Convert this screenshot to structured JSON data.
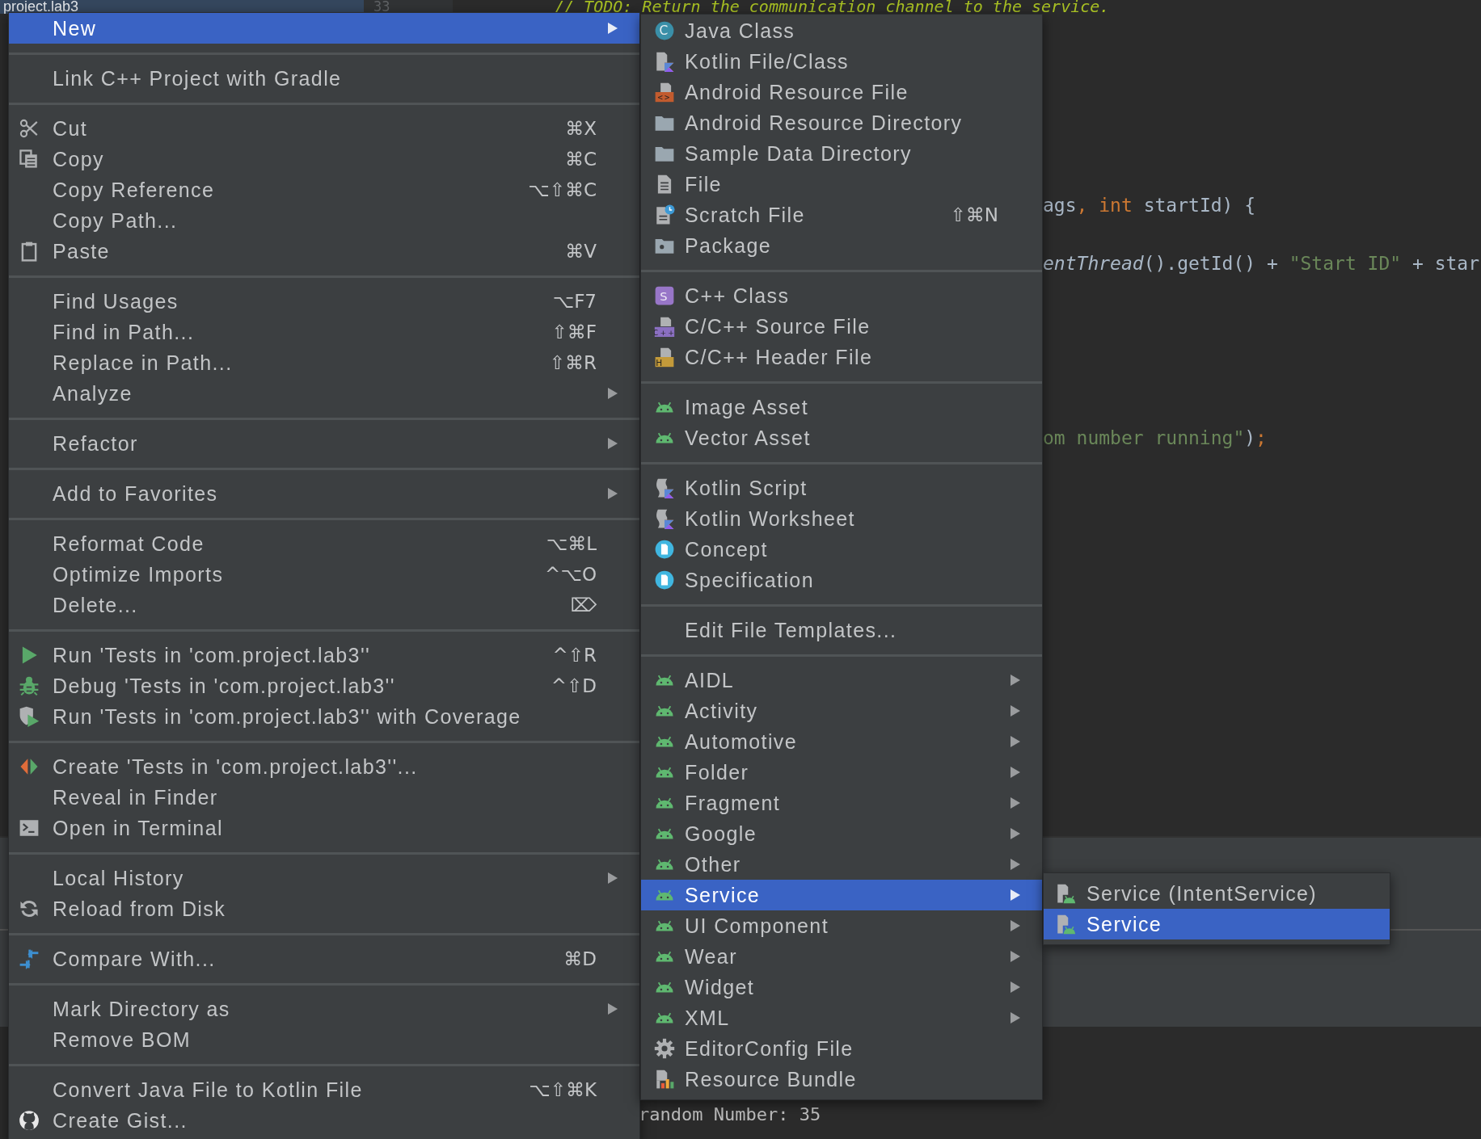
{
  "editor": {
    "project_tab": "project.lab3",
    "line_number": "33",
    "comment": "// TODO: Return the communication channel to the service.",
    "code_lines": [
      {
        "segments": [
          {
            "kind": "plain",
            "text": "ags"
          },
          {
            "kind": "keyword",
            "text": ", int"
          },
          {
            "kind": "plain",
            "text": " startId) {"
          }
        ]
      },
      {
        "segments": [
          {
            "kind": "italic",
            "text": "entThread"
          },
          {
            "kind": "plain",
            "text": "().getId() + "
          },
          {
            "kind": "string",
            "text": "\"Start ID\""
          },
          {
            "kind": "plain",
            "text": " + star"
          }
        ]
      },
      {
        "segments": [
          {
            "kind": "string",
            "text": "om number running\""
          },
          {
            "kind": "plain",
            "text": ")"
          },
          {
            "kind": "keyword",
            "text": ";"
          }
        ]
      }
    ]
  },
  "console": {
    "output": "random Number: 35"
  },
  "context_menu": {
    "groups": [
      {
        "items": [
          {
            "label": "New",
            "submenu": true,
            "selected": true
          }
        ]
      },
      {
        "items": [
          {
            "label": "Link C++ Project with Gradle",
            "submenu": false,
            "selected": false
          }
        ]
      },
      {
        "items": [
          {
            "label": "Cut",
            "shortcut": "⌘X",
            "submenu": false,
            "selected": false
          },
          {
            "label": "Copy",
            "shortcut": "⌘C",
            "submenu": false,
            "selected": false
          },
          {
            "label": "Copy Reference",
            "shortcut": "⌥⇧⌘C",
            "submenu": false,
            "selected": false
          },
          {
            "label": "Copy Path...",
            "submenu": false,
            "selected": false
          },
          {
            "label": "Paste",
            "shortcut": "⌘V",
            "submenu": false,
            "selected": false
          }
        ]
      },
      {
        "items": [
          {
            "label": "Find Usages",
            "shortcut": "⌥F7",
            "submenu": false,
            "selected": false
          },
          {
            "label": "Find in Path...",
            "shortcut": "⇧⌘F",
            "submenu": false,
            "selected": false
          },
          {
            "label": "Replace in Path...",
            "shortcut": "⇧⌘R",
            "submenu": false,
            "selected": false
          },
          {
            "label": "Analyze",
            "submenu": true,
            "selected": false
          }
        ]
      },
      {
        "items": [
          {
            "label": "Refactor",
            "submenu": true,
            "selected": false
          }
        ]
      },
      {
        "items": [
          {
            "label": "Add to Favorites",
            "submenu": true,
            "selected": false
          }
        ]
      },
      {
        "items": [
          {
            "label": "Reformat Code",
            "shortcut": "⌥⌘L",
            "submenu": false,
            "selected": false
          },
          {
            "label": "Optimize Imports",
            "shortcut": "^⌥O",
            "submenu": false,
            "selected": false
          },
          {
            "label": "Delete...",
            "shortcut": "⌦",
            "submenu": false,
            "selected": false
          }
        ]
      },
      {
        "items": [
          {
            "label": "Run 'Tests in 'com.project.lab3''",
            "shortcut": "^⇧R",
            "submenu": false,
            "selected": false
          },
          {
            "label": "Debug 'Tests in 'com.project.lab3''",
            "shortcut": "^⇧D",
            "submenu": false,
            "selected": false
          },
          {
            "label": "Run 'Tests in 'com.project.lab3'' with Coverage",
            "submenu": false,
            "selected": false
          }
        ]
      },
      {
        "items": [
          {
            "label": "Create 'Tests in 'com.project.lab3''...",
            "submenu": false,
            "selected": false
          },
          {
            "label": "Reveal in Finder",
            "submenu": false,
            "selected": false
          },
          {
            "label": "Open in Terminal",
            "submenu": false,
            "selected": false
          }
        ]
      },
      {
        "items": [
          {
            "label": "Local History",
            "submenu": true,
            "selected": false
          },
          {
            "label": "Reload from Disk",
            "submenu": false,
            "selected": false
          }
        ]
      },
      {
        "items": [
          {
            "label": "Compare With...",
            "shortcut": "⌘D",
            "submenu": false,
            "selected": false
          }
        ]
      },
      {
        "items": [
          {
            "label": "Mark Directory as",
            "submenu": true,
            "selected": false
          },
          {
            "label": "Remove BOM",
            "submenu": false,
            "selected": false
          }
        ]
      },
      {
        "items": [
          {
            "label": "Convert Java File to Kotlin File",
            "shortcut": "⌥⇧⌘K",
            "submenu": false,
            "selected": false
          },
          {
            "label": "Create Gist...",
            "submenu": false,
            "selected": false
          }
        ]
      }
    ]
  },
  "new_submenu": {
    "groups": [
      {
        "items": [
          {
            "label": "Java Class",
            "icon_text": "C",
            "submenu": false,
            "selected": false
          },
          {
            "label": "Kotlin File/Class",
            "submenu": false,
            "selected": false
          },
          {
            "label": "Android Resource File",
            "icon_text": "<>",
            "submenu": false,
            "selected": false
          },
          {
            "label": "Android Resource Directory",
            "submenu": false,
            "selected": false
          },
          {
            "label": "Sample Data Directory",
            "submenu": false,
            "selected": false
          },
          {
            "label": "File",
            "submenu": false,
            "selected": false
          },
          {
            "label": "Scratch File",
            "shortcut": "⇧⌘N",
            "submenu": false,
            "selected": false
          },
          {
            "label": "Package",
            "submenu": false,
            "selected": false
          }
        ]
      },
      {
        "items": [
          {
            "label": "C++ Class",
            "icon_text": "S",
            "submenu": false,
            "selected": false
          },
          {
            "label": "C/C++ Source File",
            "icon_text": "C++",
            "submenu": false,
            "selected": false
          },
          {
            "label": "C/C++ Header File",
            "icon_text": "H",
            "submenu": false,
            "selected": false
          }
        ]
      },
      {
        "items": [
          {
            "label": "Image Asset",
            "submenu": false,
            "selected": false
          },
          {
            "label": "Vector Asset",
            "submenu": false,
            "selected": false
          }
        ]
      },
      {
        "items": [
          {
            "label": "Kotlin Script",
            "submenu": false,
            "selected": false
          },
          {
            "label": "Kotlin Worksheet",
            "submenu": false,
            "selected": false
          },
          {
            "label": "Concept",
            "submenu": false,
            "selected": false
          },
          {
            "label": "Specification",
            "submenu": false,
            "selected": false
          }
        ]
      },
      {
        "items": [
          {
            "label": "Edit File Templates...",
            "submenu": false,
            "selected": false
          }
        ]
      },
      {
        "items": [
          {
            "label": "AIDL",
            "submenu": true,
            "selected": false
          },
          {
            "label": "Activity",
            "submenu": true,
            "selected": false
          },
          {
            "label": "Automotive",
            "submenu": true,
            "selected": false
          },
          {
            "label": "Folder",
            "submenu": true,
            "selected": false
          },
          {
            "label": "Fragment",
            "submenu": true,
            "selected": false
          },
          {
            "label": "Google",
            "submenu": true,
            "selected": false
          },
          {
            "label": "Other",
            "submenu": true,
            "selected": false
          },
          {
            "label": "Service",
            "submenu": true,
            "selected": true
          },
          {
            "label": "UI Component",
            "submenu": true,
            "selected": false
          },
          {
            "label": "Wear",
            "submenu": true,
            "selected": false
          },
          {
            "label": "Widget",
            "submenu": true,
            "selected": false
          },
          {
            "label": "XML",
            "submenu": true,
            "selected": false
          },
          {
            "label": "EditorConfig File",
            "submenu": false,
            "selected": false
          },
          {
            "label": "Resource Bundle",
            "submenu": false,
            "selected": false
          }
        ]
      }
    ]
  },
  "service_submenu": {
    "groups": [
      {
        "items": [
          {
            "label": "Service (IntentService)",
            "submenu": false,
            "selected": false
          },
          {
            "label": "Service",
            "submenu": false,
            "selected": true
          }
        ]
      }
    ]
  }
}
